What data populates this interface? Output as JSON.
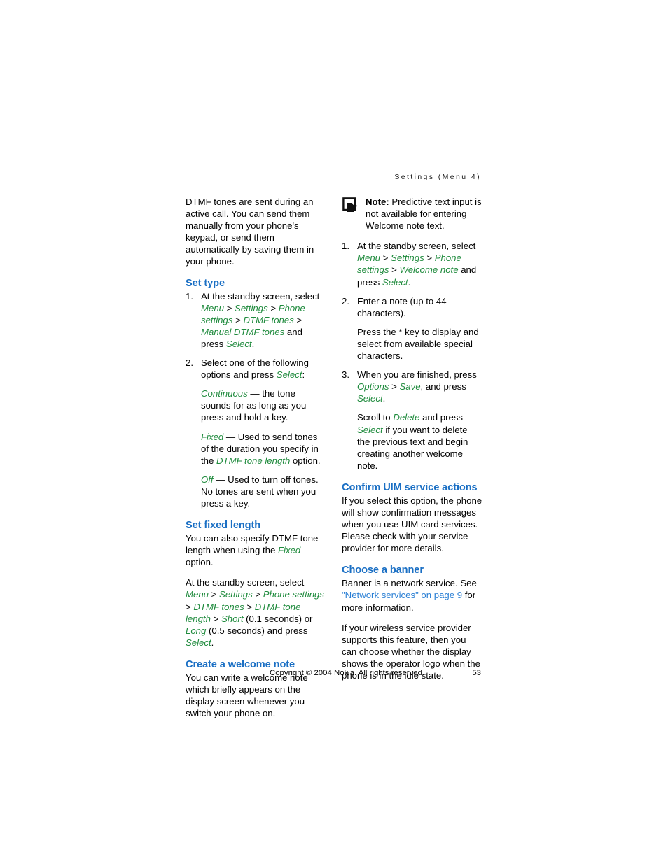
{
  "header": {
    "running_title": "Settings (Menu 4)"
  },
  "left_column": {
    "intro": {
      "text": "DTMF tones are sent during an active call. You can send them manually from your phone's keypad, or send them automatically by saving them in your phone."
    },
    "set_type": {
      "heading": "Set type",
      "step1": {
        "number": "1.",
        "lead": "At the standby screen, select ",
        "path_menu": "Menu",
        "sep1": " > ",
        "path_settings": "Settings",
        "sep2": " > ",
        "path_phone_settings": "Phone settings",
        "sep3": " > ",
        "path_dtmf_tones": "DTMF tones",
        "sep4": " > ",
        "path_manual": "Manual DTMF tones",
        "mid": " and press ",
        "path_select": "Select",
        "end": "."
      },
      "step2": {
        "number": "2.",
        "lead": "Select one of the following options and press ",
        "path_select": "Select",
        "end": ":",
        "options": [
          {
            "term": "Continuous",
            "dash": " — ",
            "desc": "the tone sounds for as long as you press and hold a key."
          },
          {
            "term": "Fixed",
            "dash": " — ",
            "desc_before": "Used to send tones of the duration you specify in the ",
            "term2": "DTMF tone length",
            "desc_after": " option."
          },
          {
            "term": "Off",
            "dash": " — ",
            "desc": "Used to turn off tones. No tones are sent when you press a key."
          }
        ]
      }
    },
    "set_fixed_length": {
      "heading": "Set fixed length",
      "para1_before": "You can also specify DTMF tone length when using the ",
      "para1_term": "Fixed",
      "para1_after": " option.",
      "para2": {
        "lead": "At the standby screen, select ",
        "path_menu": "Menu",
        "sep1": " > ",
        "path_settings": "Settings",
        "sep2": " > ",
        "path_phone_settings": "Phone settings",
        "sep3": " > ",
        "path_dtmf_tones": "DTMF tones",
        "sep4": " > ",
        "path_dtmf_tone_length": "DTMF tone length",
        "sep5": " > ",
        "path_short": "Short",
        "short_time": " (0.1 seconds) or ",
        "path_long": "Long",
        "long_time": " (0.5 seconds) and press ",
        "path_select": "Select",
        "end": "."
      }
    },
    "create_welcome_note": {
      "heading": "Create a welcome note",
      "text": "You can write a welcome note which briefly appears on the display screen whenever you switch your phone on."
    }
  },
  "right_column": {
    "note": {
      "icon": "note-pointing-hand-icon",
      "label": "Note:",
      "text": " Predictive text input is not available for entering Welcome note text."
    },
    "welcome_steps": {
      "step1": {
        "number": "1.",
        "lead": "At the standby screen, select ",
        "path_menu": "Menu",
        "sep1": " > ",
        "path_settings": "Settings",
        "sep2": " > ",
        "path_phone_settings": "Phone settings",
        "sep3": " > ",
        "path_welcome_note": "Welcome note",
        "mid": " and press ",
        "path_select": "Select",
        "end": "."
      },
      "step2": {
        "number": "2.",
        "text": "Enter a note (up to 44 characters).",
        "para2": "Press the * key to display and select from available special characters."
      },
      "step3": {
        "number": "3.",
        "lead": "When you are finished, press ",
        "path_options": "Options",
        "sep1": " > ",
        "path_save": "Save",
        "mid": ", and press ",
        "path_select": "Select",
        "end": ".",
        "para2_lead": "Scroll to ",
        "para2_delete": "Delete",
        "para2_mid": " and press ",
        "para2_select": "Select",
        "para2_end": " if you want to delete the previous text and begin creating another welcome note."
      }
    },
    "confirm_uim": {
      "heading": "Confirm UIM service actions",
      "text": "If you select this option, the phone will show confirmation messages when you use UIM card services. Please check with your service provider for more details."
    },
    "choose_banner": {
      "heading": "Choose a banner",
      "para1_before": "Banner is a network service. See ",
      "para1_link": "\"Network services\" on page 9",
      "para1_after": " for more information.",
      "para2": "If your wireless service provider supports this feature, then you can choose whether the display shows the operator logo when the phone is in the idle state."
    }
  },
  "footer": {
    "copyright": "Copyright © 2004 Nokia. All rights reserved.",
    "page_number": "53"
  },
  "colors": {
    "heading_blue": "#1a6fc4",
    "link_blue": "#2a7fd4",
    "ui_green": "#1e8a3c",
    "body_black": "#000000",
    "page_background": "#ffffff"
  }
}
